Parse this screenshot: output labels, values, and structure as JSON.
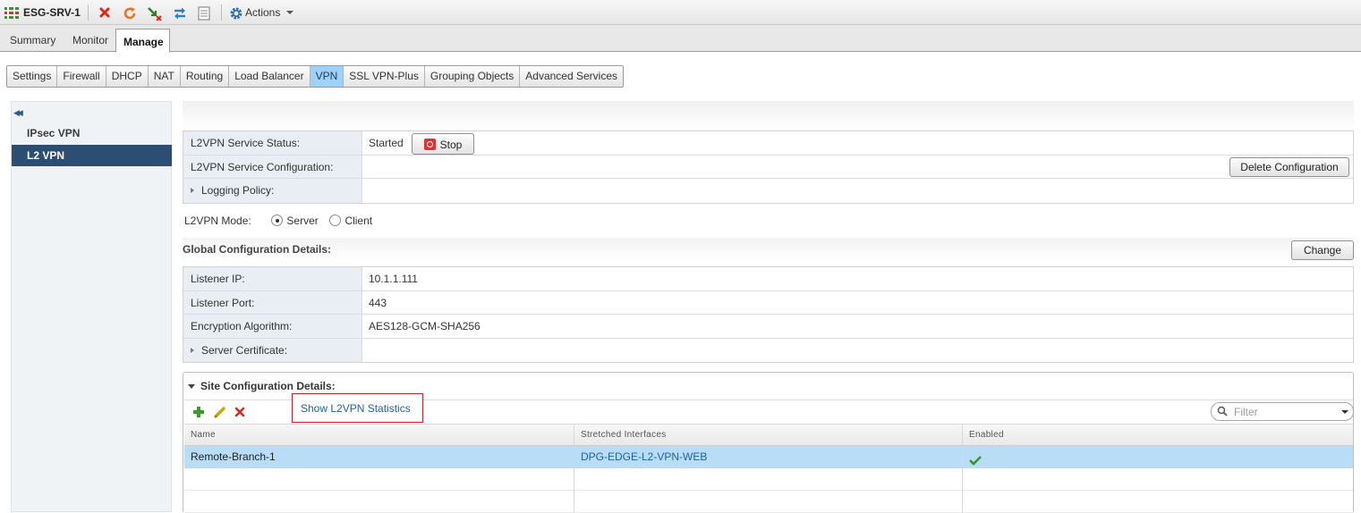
{
  "header": {
    "title": "ESG-SRV-1",
    "actions_label": "Actions"
  },
  "main_tabs": [
    {
      "label": "Summary"
    },
    {
      "label": "Monitor"
    },
    {
      "label": "Manage"
    }
  ],
  "sub_tabs": [
    {
      "label": "Settings"
    },
    {
      "label": "Firewall"
    },
    {
      "label": "DHCP"
    },
    {
      "label": "NAT"
    },
    {
      "label": "Routing"
    },
    {
      "label": "Load Balancer"
    },
    {
      "label": "VPN"
    },
    {
      "label": "SSL VPN-Plus"
    },
    {
      "label": "Grouping Objects"
    },
    {
      "label": "Advanced Services"
    }
  ],
  "active_sub_tab": "VPN",
  "sidebar": {
    "items": [
      {
        "label": "IPsec VPN"
      },
      {
        "label": "L2 VPN"
      }
    ]
  },
  "service": {
    "status_label": "L2VPN Service Status:",
    "status_value": "Started",
    "stop_label": "Stop",
    "config_label": "L2VPN Service Configuration:",
    "delete_label": "Delete Configuration",
    "logging_label": "Logging Policy:"
  },
  "mode": {
    "label": "L2VPN Mode:",
    "server_label": "Server",
    "client_label": "Client",
    "selected": "Server"
  },
  "global": {
    "title": "Global Configuration Details:",
    "change_label": "Change",
    "listener_ip_label": "Listener IP:",
    "listener_ip": "10.1.1.111",
    "listener_port_label": "Listener Port:",
    "listener_port": "443",
    "encryption_label": "Encryption Algorithm:",
    "encryption": "AES128-GCM-SHA256",
    "certificate_label": "Server Certificate:"
  },
  "site": {
    "title": "Site Configuration Details:",
    "stats_link": "Show L2VPN Statistics",
    "filter_placeholder": "Filter",
    "columns": [
      "Name",
      "Stretched Interfaces",
      "Enabled"
    ],
    "rows": [
      {
        "name": "Remote-Branch-1",
        "interfaces": "DPG-EDGE-L2-VPN-WEB",
        "enabled": true
      }
    ]
  },
  "colors": {
    "accent": "#2b4e72",
    "selected_tab": "#9fd0f6",
    "selected_row": "#b9ddf6",
    "link": "#1b61a8"
  }
}
